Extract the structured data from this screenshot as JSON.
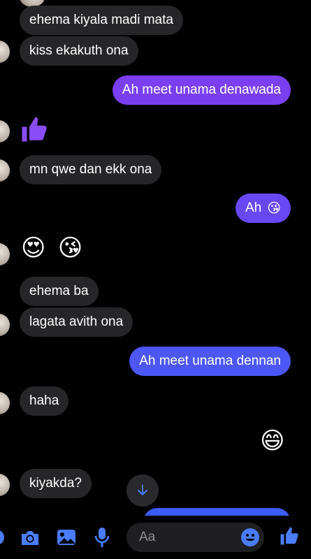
{
  "messages": [
    {
      "id": 1,
      "side": "incoming",
      "text": "ehema kiyala madi mata"
    },
    {
      "id": 2,
      "side": "incoming",
      "text": "kiss ekakuth ona"
    },
    {
      "id": 3,
      "side": "outgoing",
      "text": "Ah meet unama denawada"
    },
    {
      "id": 4,
      "side": "incoming",
      "type": "like",
      "icon": "thumbs-up-icon"
    },
    {
      "id": 5,
      "side": "incoming",
      "text": "mn qwe dan ekk ona"
    },
    {
      "id": 6,
      "side": "outgoing",
      "text": "Ah",
      "emoji": "😘"
    },
    {
      "id": 7,
      "side": "incoming",
      "emoji": "😍 😘"
    },
    {
      "id": 8,
      "side": "incoming",
      "text": "ehema ba"
    },
    {
      "id": 9,
      "side": "incoming",
      "text": "lagata avith ona"
    },
    {
      "id": 10,
      "side": "outgoing",
      "text": "Ah meet unama dennan"
    },
    {
      "id": 11,
      "side": "incoming",
      "text": "haha"
    },
    {
      "id": 12,
      "side": "outgoing",
      "emoji": "😄"
    },
    {
      "id": 13,
      "side": "incoming",
      "text": "kiyakda?"
    }
  ],
  "composer": {
    "placeholder": "Aa"
  },
  "colors": {
    "incoming_bubble": "#262628",
    "outgoing_top": "#7b3ff2",
    "outgoing_bottom": "#3c5cf5",
    "accent": "#4a7cff"
  },
  "toolbar": {
    "icons": [
      "camera-icon",
      "image-icon",
      "microphone-icon",
      "emoji-icon",
      "thumbs-up-icon"
    ]
  }
}
